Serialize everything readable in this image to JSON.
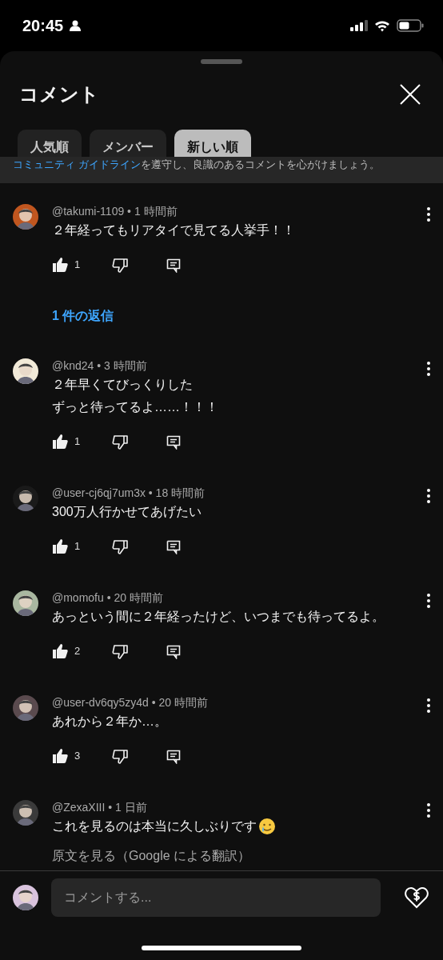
{
  "status_bar": {
    "time": "20:45"
  },
  "sheet": {
    "title": "コメント"
  },
  "tabs": [
    {
      "label": "人気順",
      "selected": false
    },
    {
      "label": "メンバー",
      "selected": false
    },
    {
      "label": "新しい順",
      "selected": true
    }
  ],
  "guideline": {
    "link": "コミュニティ ガイドライン",
    "text": "を遵守し、良識のあるコメントを心がけましょう。"
  },
  "comments": [
    {
      "meta": "@takumi-1109 • 1 時間前",
      "text": [
        "２年経ってもリアタイで見てる人挙手！！"
      ],
      "likes": "1",
      "replies": "1 件の返信",
      "has_emoji": false
    },
    {
      "meta": "@knd24 • 3 時間前",
      "text": [
        "２年早くてびっくりした",
        "ずっと待ってるよ……！！！"
      ],
      "likes": "1",
      "has_emoji": false
    },
    {
      "meta": "@user-cj6qj7um3x • 18 時間前",
      "text": [
        "300万人行かせてあげたい"
      ],
      "likes": "1",
      "has_emoji": false
    },
    {
      "meta": "@momofu • 20 時間前",
      "text": [
        "あっという間に２年経ったけど、いつまでも待ってるよ。"
      ],
      "likes": "2",
      "has_emoji": false
    },
    {
      "meta": "@user-dv6qy5zy4d • 20 時間前",
      "text": [
        "あれから２年か…。"
      ],
      "likes": "3",
      "has_emoji": false
    },
    {
      "meta": "@ZexaXIII • 1 日前",
      "text": [
        "これを見るのは本当に久しぶりです"
      ],
      "has_emoji": true,
      "translate": "原文を見る（Google による翻訳）"
    }
  ],
  "composer": {
    "placeholder": "コメントする..."
  }
}
